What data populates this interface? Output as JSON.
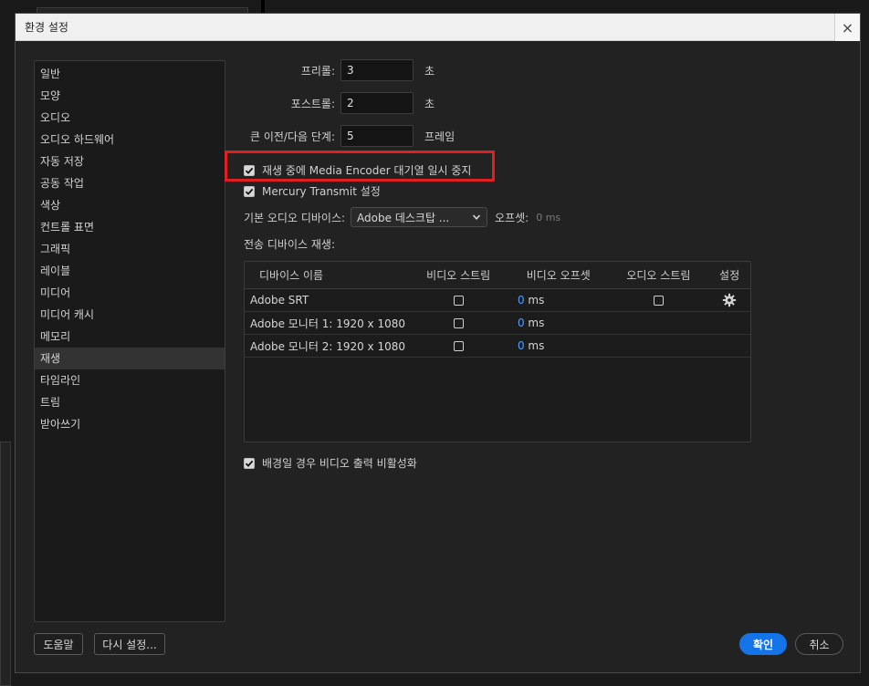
{
  "dialog": {
    "title": "환경 설정",
    "close_symbol": "×"
  },
  "sidebar": {
    "items": [
      {
        "label": "일반"
      },
      {
        "label": "모양"
      },
      {
        "label": "오디오"
      },
      {
        "label": "오디오 하드웨어"
      },
      {
        "label": "자동 저장"
      },
      {
        "label": "공동 작업"
      },
      {
        "label": "색상"
      },
      {
        "label": "컨트롤 표면"
      },
      {
        "label": "그래픽"
      },
      {
        "label": "레이블"
      },
      {
        "label": "미디어"
      },
      {
        "label": "미디어 캐시"
      },
      {
        "label": "메모리"
      },
      {
        "label": "재생"
      },
      {
        "label": "타임라인"
      },
      {
        "label": "트림"
      },
      {
        "label": "받아쓰기"
      }
    ],
    "selected": "재생"
  },
  "playback": {
    "preroll": {
      "label": "프리롤:",
      "value": "3",
      "unit": "초"
    },
    "postroll": {
      "label": "포스트롤:",
      "value": "2",
      "unit": "초"
    },
    "step": {
      "label": "큰 이전/다음 단계:",
      "value": "5",
      "unit": "프레임"
    },
    "pause_encoder": {
      "label": "재생 중에 Media Encoder 대기열 일시 중지",
      "checked": true
    },
    "mercury": {
      "label": "Mercury Transmit 설정",
      "checked": true
    },
    "audio_device": {
      "label": "기본 오디오 디바이스:",
      "value": "Adobe 데스크탑 ...",
      "offset_label": "오프셋:",
      "offset_value": "0 ms"
    },
    "transmit_label": "전송 디바이스 재생:",
    "disable_video_bg": {
      "label": "배경일 경우 비디오 출력 비활성화",
      "checked": true
    }
  },
  "device_table": {
    "headers": [
      "디바이스 이름",
      "비디오 스트림",
      "비디오 오프셋",
      "오디오 스트림",
      "설정"
    ],
    "rows": [
      {
        "name": "Adobe SRT",
        "video_offset": "0",
        "unit": "ms",
        "has_audio": true,
        "has_settings": true
      },
      {
        "name": "Adobe 모니터 1: 1920 x 1080",
        "video_offset": "0",
        "unit": "ms",
        "has_audio": false,
        "has_settings": false
      },
      {
        "name": "Adobe 모니터 2: 1920 x 1080",
        "video_offset": "0",
        "unit": "ms",
        "has_audio": false,
        "has_settings": false
      }
    ]
  },
  "footer": {
    "help": "도움말",
    "reset": "다시 설정...",
    "ok": "확인",
    "cancel": "취소"
  },
  "colors": {
    "highlight": "#e02020",
    "primary": "#1473e6",
    "link": "#4aa0ff"
  },
  "icons": {
    "checkbox": "checkmark-icon",
    "settings": "gear-icon",
    "dropdown": "chevron-down-icon"
  }
}
